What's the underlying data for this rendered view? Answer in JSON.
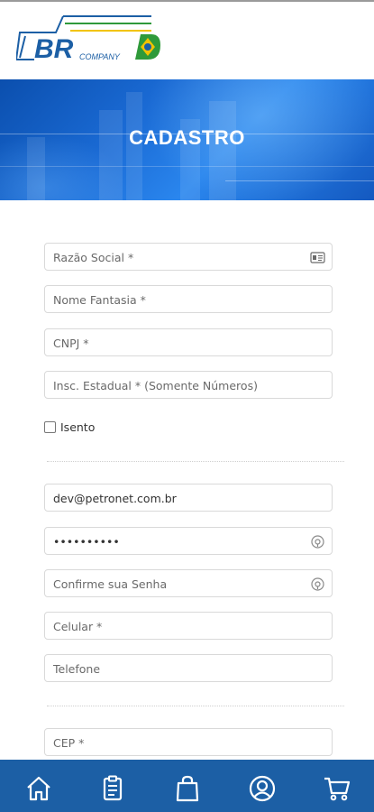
{
  "brand": {
    "logo_text": "BR",
    "logo_subtext": "COMPANY",
    "colors": {
      "blue": "#1c5fa5",
      "green": "#2f9a3a",
      "yellow": "#f2c300"
    }
  },
  "banner": {
    "title": "CADASTRO"
  },
  "form": {
    "razao_social": {
      "placeholder": "Razão Social *",
      "icon": "id-card-icon"
    },
    "nome_fantasia": {
      "placeholder": "Nome Fantasia *"
    },
    "cnpj": {
      "placeholder": "CNPJ *"
    },
    "insc_estadual": {
      "placeholder": "Insc. Estadual * (Somente Números)"
    },
    "isento": {
      "label": "Isento",
      "checked": false
    },
    "email": {
      "value": "dev@petronet.com.br"
    },
    "senha": {
      "value": "••••••••••",
      "icon": "eye-icon"
    },
    "confirme_senha": {
      "placeholder": "Confirme sua Senha",
      "icon": "eye-icon"
    },
    "celular": {
      "placeholder": "Celular *"
    },
    "telefone": {
      "placeholder": "Telefone"
    },
    "cep": {
      "placeholder": "CEP *"
    }
  },
  "bottom_nav": {
    "items": [
      {
        "icon": "home-icon"
      },
      {
        "icon": "clipboard-icon"
      },
      {
        "icon": "shopping-bag-icon"
      },
      {
        "icon": "user-icon"
      },
      {
        "icon": "cart-icon"
      }
    ]
  }
}
